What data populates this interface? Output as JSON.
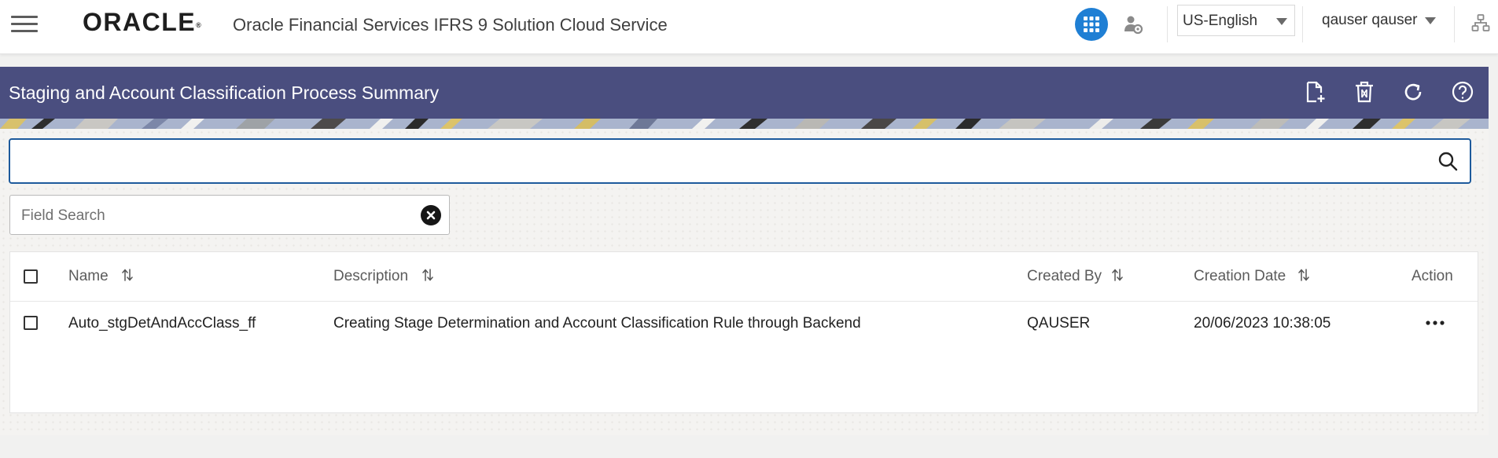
{
  "header": {
    "logo_text": "ORACLE",
    "logo_mark": "®",
    "app_title": "Oracle Financial Services IFRS 9 Solution Cloud Service",
    "apps_icon": "grid-icon",
    "user_settings_icon": "user-gear-icon",
    "language": "US-English",
    "user": "qauser qauser",
    "nav_icon": "hierarchy-icon"
  },
  "page": {
    "title": "Staging and Account Classification Process Summary",
    "toolbar_icons": [
      "add-document-icon",
      "delete-icon",
      "refresh-icon",
      "help-icon"
    ]
  },
  "search": {
    "value": "",
    "field_search_placeholder": "Field Search"
  },
  "table": {
    "columns": {
      "name": "Name",
      "description": "Description",
      "created_by": "Created By",
      "creation_date": "Creation Date",
      "action": "Action"
    },
    "rows": [
      {
        "name": "Auto_stgDetAndAccClass_ff",
        "description": "Creating Stage Determination and Account Classification Rule through Backend",
        "created_by": "QAUSER",
        "creation_date": "20/06/2023 10:38:05",
        "action_icon": "more-horizontal-icon"
      }
    ]
  },
  "colors": {
    "title_band": "#4a4e7f",
    "apps_button": "#1f7fd4",
    "search_border": "#1d5a9c"
  }
}
